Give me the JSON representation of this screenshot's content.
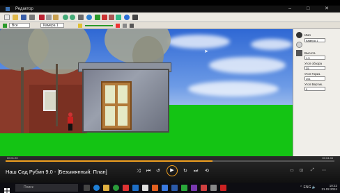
{
  "app": {
    "title": "Редактор",
    "window_buttons": "–  □  ✕"
  },
  "toolbar2": {
    "view_select": "Все сезоны",
    "camera_select": "Камера 1"
  },
  "properties": {
    "name_label": "Имя",
    "name_value": "Камера 1",
    "height_label": "Высота",
    "height_value": "1.5",
    "fov_label": "Угол обзора",
    "fov_value": "25",
    "hangle_label": "Угол Гориз.",
    "hangle_value": "261",
    "vangle_label": "Угол Вертик.",
    "vangle_value": "0"
  },
  "player": {
    "title": "Наш Сад Рубин 9.0 - [Безымянный: План]",
    "time_elapsed": "00:01:20",
    "time_total": "00:04:46",
    "progress": 0.63
  },
  "taskbar": {
    "search_placeholder": "Поиск",
    "lang": "ENG",
    "clock_time": "10:22",
    "clock_date": "21.02.2024"
  },
  "colors": {
    "accent": "#f0a020",
    "grass": "#14c414",
    "sky": "#6d9be6"
  }
}
